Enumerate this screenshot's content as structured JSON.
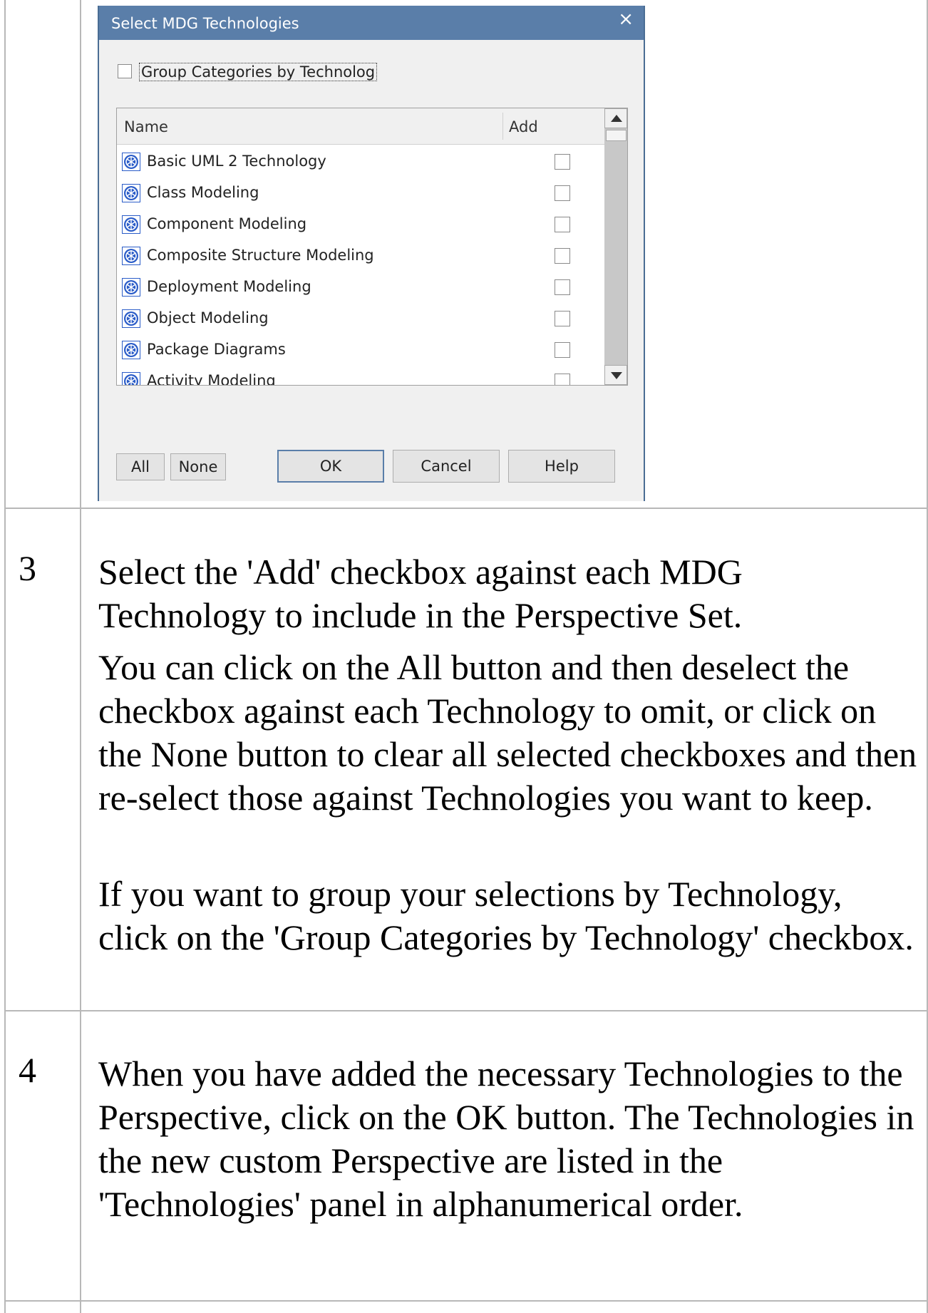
{
  "dialog": {
    "title": "Select MDG Technologies",
    "close_symbol": "×",
    "group_checkbox_label": "Group Categories by Technolog",
    "group_checked": false,
    "columns": {
      "name": "Name",
      "add": "Add"
    },
    "items": [
      {
        "label": "Basic UML 2 Technology",
        "checked": false
      },
      {
        "label": "Class Modeling",
        "checked": false
      },
      {
        "label": "Component Modeling",
        "checked": false
      },
      {
        "label": "Composite Structure Modeling",
        "checked": false
      },
      {
        "label": "Deployment Modeling",
        "checked": false
      },
      {
        "label": "Object Modeling",
        "checked": false
      },
      {
        "label": "Package Diagrams",
        "checked": false
      },
      {
        "label": "Activity Modeling",
        "checked": false
      }
    ],
    "item_icon": "mdg-technology-icon",
    "buttons": {
      "all": "All",
      "none": "None",
      "ok": "OK",
      "cancel": "Cancel",
      "help": "Help"
    },
    "colors": {
      "title_bar": "#5a7ea9",
      "icon": "#2a5cc8"
    }
  },
  "steps": [
    {
      "number": "3",
      "paragraphs": [
        "Select the 'Add' checkbox against each MDG Technology to include in the Perspective Set.",
        "You can click on the All button and then deselect the checkbox against each Technology to omit, or click on the None button to clear all selected checkboxes and then re-select those against Technologies you want to keep.",
        "If you want to group your selections by Technology, click on the 'Group Categories by Technology' checkbox."
      ]
    },
    {
      "number": "4",
      "paragraphs": [
        "When you have added the necessary Technologies to the Perspective, click on the OK button. The Technologies in the new custom Perspective are listed in the 'Technologies' panel in alphanumerical order."
      ]
    }
  ]
}
